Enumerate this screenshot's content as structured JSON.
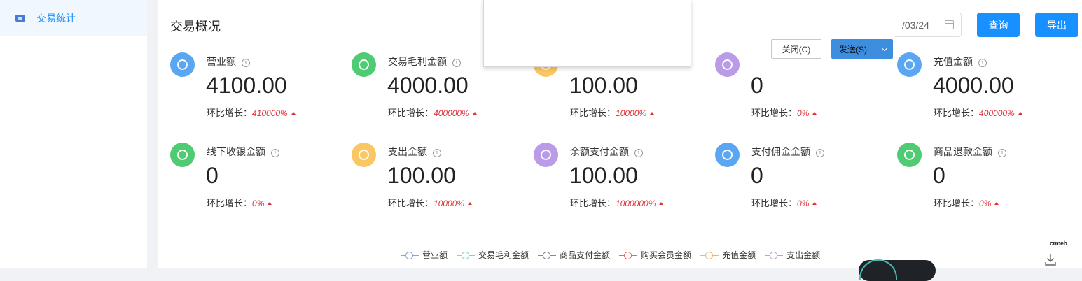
{
  "sidebar": {
    "items": [
      {
        "label": "交易统计",
        "icon": "wallet-icon"
      }
    ]
  },
  "header": {
    "title": "交易概况",
    "date_partial": "/03/24",
    "query_label": "查询",
    "export_label": "导出"
  },
  "popup": {
    "close_label": "关闭(C)",
    "send_label": "发送(S)"
  },
  "growth_label": "环比增长：",
  "cards": [
    {
      "label": "营业额",
      "value": "4100.00",
      "growth": "410000%",
      "color": "#5aa6f2",
      "icon": "pie-chart-icon"
    },
    {
      "label": "交易毛利金额",
      "value": "4000.00",
      "growth": "400000%",
      "color": "#4ecb73",
      "icon": "yen-coin-icon"
    },
    {
      "label": "",
      "value": "100.00",
      "growth": "10000%",
      "color": "#fbc763",
      "icon": "bag-icon"
    },
    {
      "label": "",
      "value": "0",
      "growth": "0%",
      "color": "#b99be8",
      "icon": "diamond-icon"
    },
    {
      "label": "充值金额",
      "value": "4000.00",
      "growth": "400000%",
      "color": "#5aa6f2",
      "icon": "recharge-icon"
    },
    {
      "label": "线下收银金额",
      "value": "0",
      "growth": "0%",
      "color": "#4ecb73",
      "icon": "cash-register-icon"
    },
    {
      "label": "支出金额",
      "value": "100.00",
      "growth": "10000%",
      "color": "#fbc763",
      "icon": "expense-icon"
    },
    {
      "label": "余额支付金额",
      "value": "100.00",
      "growth": "1000000%",
      "color": "#b99be8",
      "icon": "money-bag-icon"
    },
    {
      "label": "支付佣金金额",
      "value": "0",
      "growth": "0%",
      "color": "#5aa6f2",
      "icon": "commission-icon"
    },
    {
      "label": "商品退款金额",
      "value": "0",
      "growth": "0%",
      "color": "#4ecb73",
      "icon": "refund-icon"
    }
  ],
  "legend": [
    {
      "name": "营业额",
      "color": "#8aa6cf"
    },
    {
      "name": "交易毛利金额",
      "color": "#7fd6c2"
    },
    {
      "name": "商品支付金额",
      "color": "#7d8a9c"
    },
    {
      "name": "购买会员金额",
      "color": "#e8696b"
    },
    {
      "name": "充值金额",
      "color": "#f5b561"
    },
    {
      "name": "支出金额",
      "color": "#c39be4"
    }
  ],
  "brand": "crmeb"
}
